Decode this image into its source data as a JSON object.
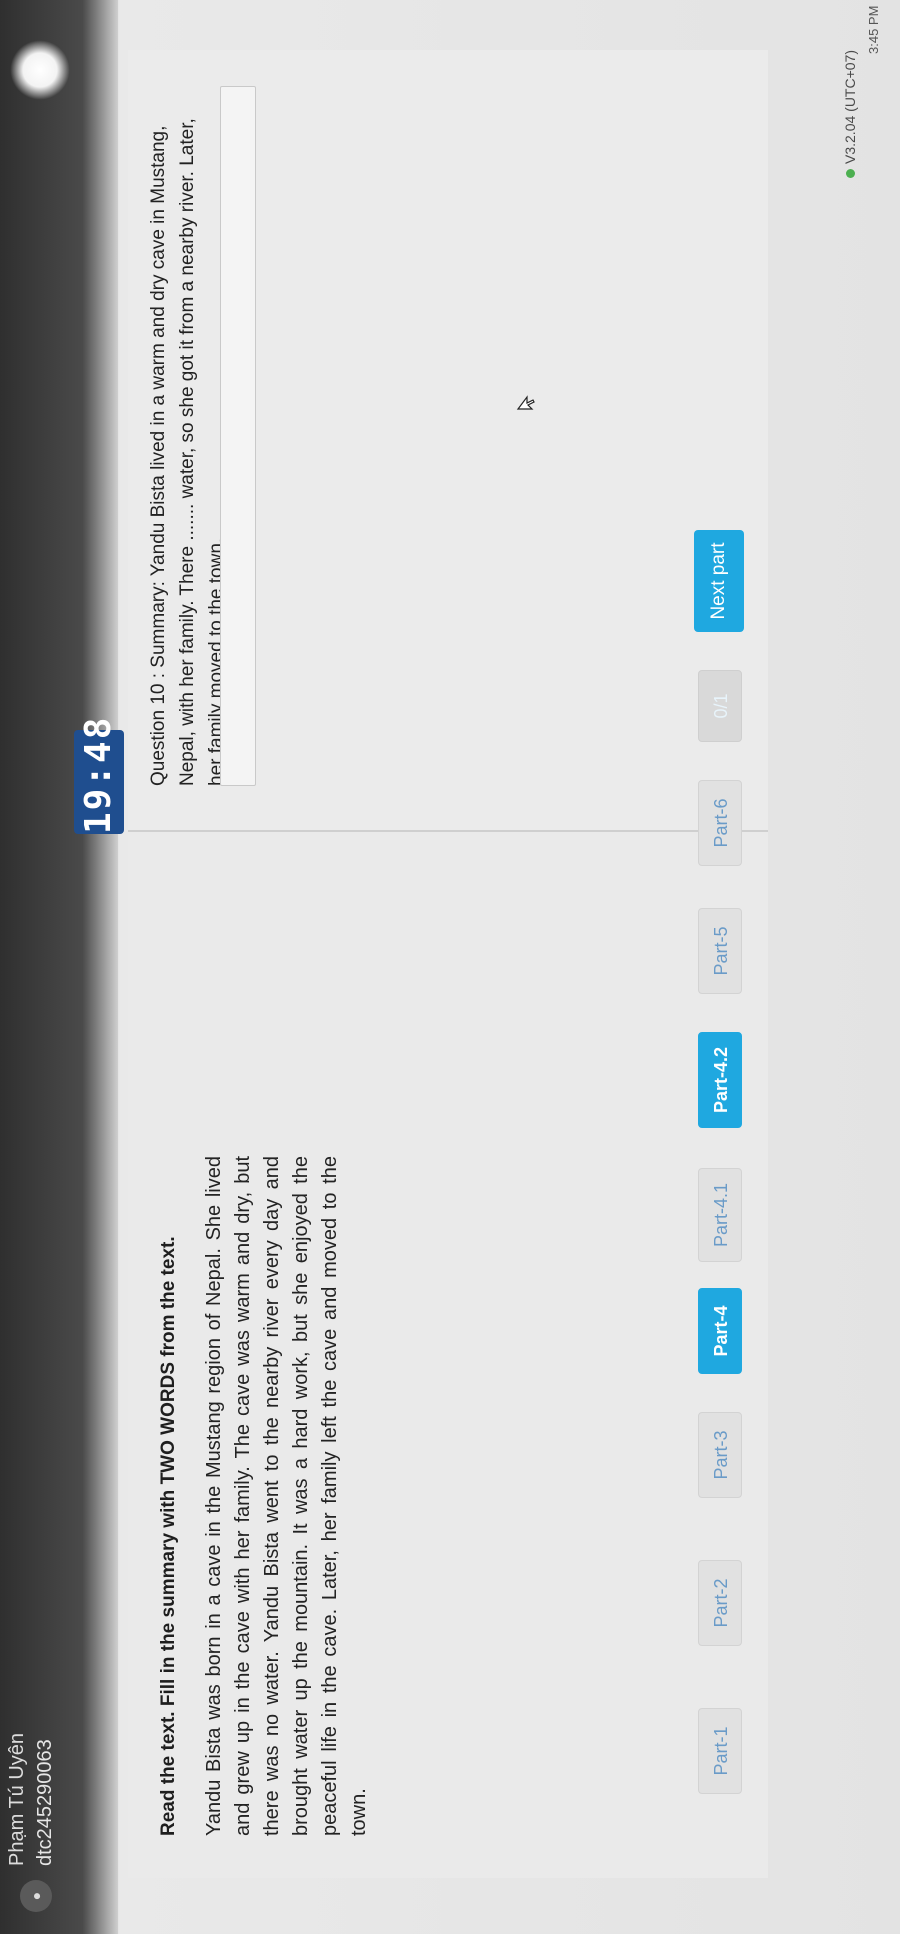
{
  "user": {
    "name": "Phạm Tú Uyên",
    "id": "dtc245290063",
    "avatar_glyph": "●"
  },
  "timer": {
    "display": "19:48"
  },
  "reading": {
    "instruction": "Read the text. Fill in the summary with TWO WORDS from the text.",
    "passage": "Yandu Bista was born in a cave in the Mustang region of Nepal. She lived and grew up in the cave with her family. The cave was warm and dry, but there was no water. Yandu Bista went to the nearby river every day and brought water up the mountain. It was a hard work, but she enjoyed the peaceful life in the cave. Later, her family left the cave and moved to the town."
  },
  "question": {
    "text": "Question 10 : Summary: Yandu Bista lived in a warm and dry cave in Mustang, Nepal, with her family. There ....... water, so she got it from a nearby river. Later, her family moved to the town.",
    "answer_value": "",
    "answer_placeholder": ""
  },
  "nav": {
    "parts": [
      "Part-1",
      "Part-2",
      "Part-3",
      "Part-4",
      "Part-4.1",
      "Part-4.2",
      "Part-5",
      "Part-6"
    ],
    "active_parts": [
      "Part-4",
      "Part-4.2"
    ],
    "page_counter": "0/1",
    "next_label": "Next part"
  },
  "footer": {
    "version": "V3.2.04 (UTC+07)",
    "clock": "3:45 PM"
  },
  "colors": {
    "accent": "#1fa8e0",
    "timer_bg": "#1f4e8f",
    "status_ok": "#4caf50"
  },
  "icons": {
    "cursor": "mouse-pointer-icon"
  }
}
